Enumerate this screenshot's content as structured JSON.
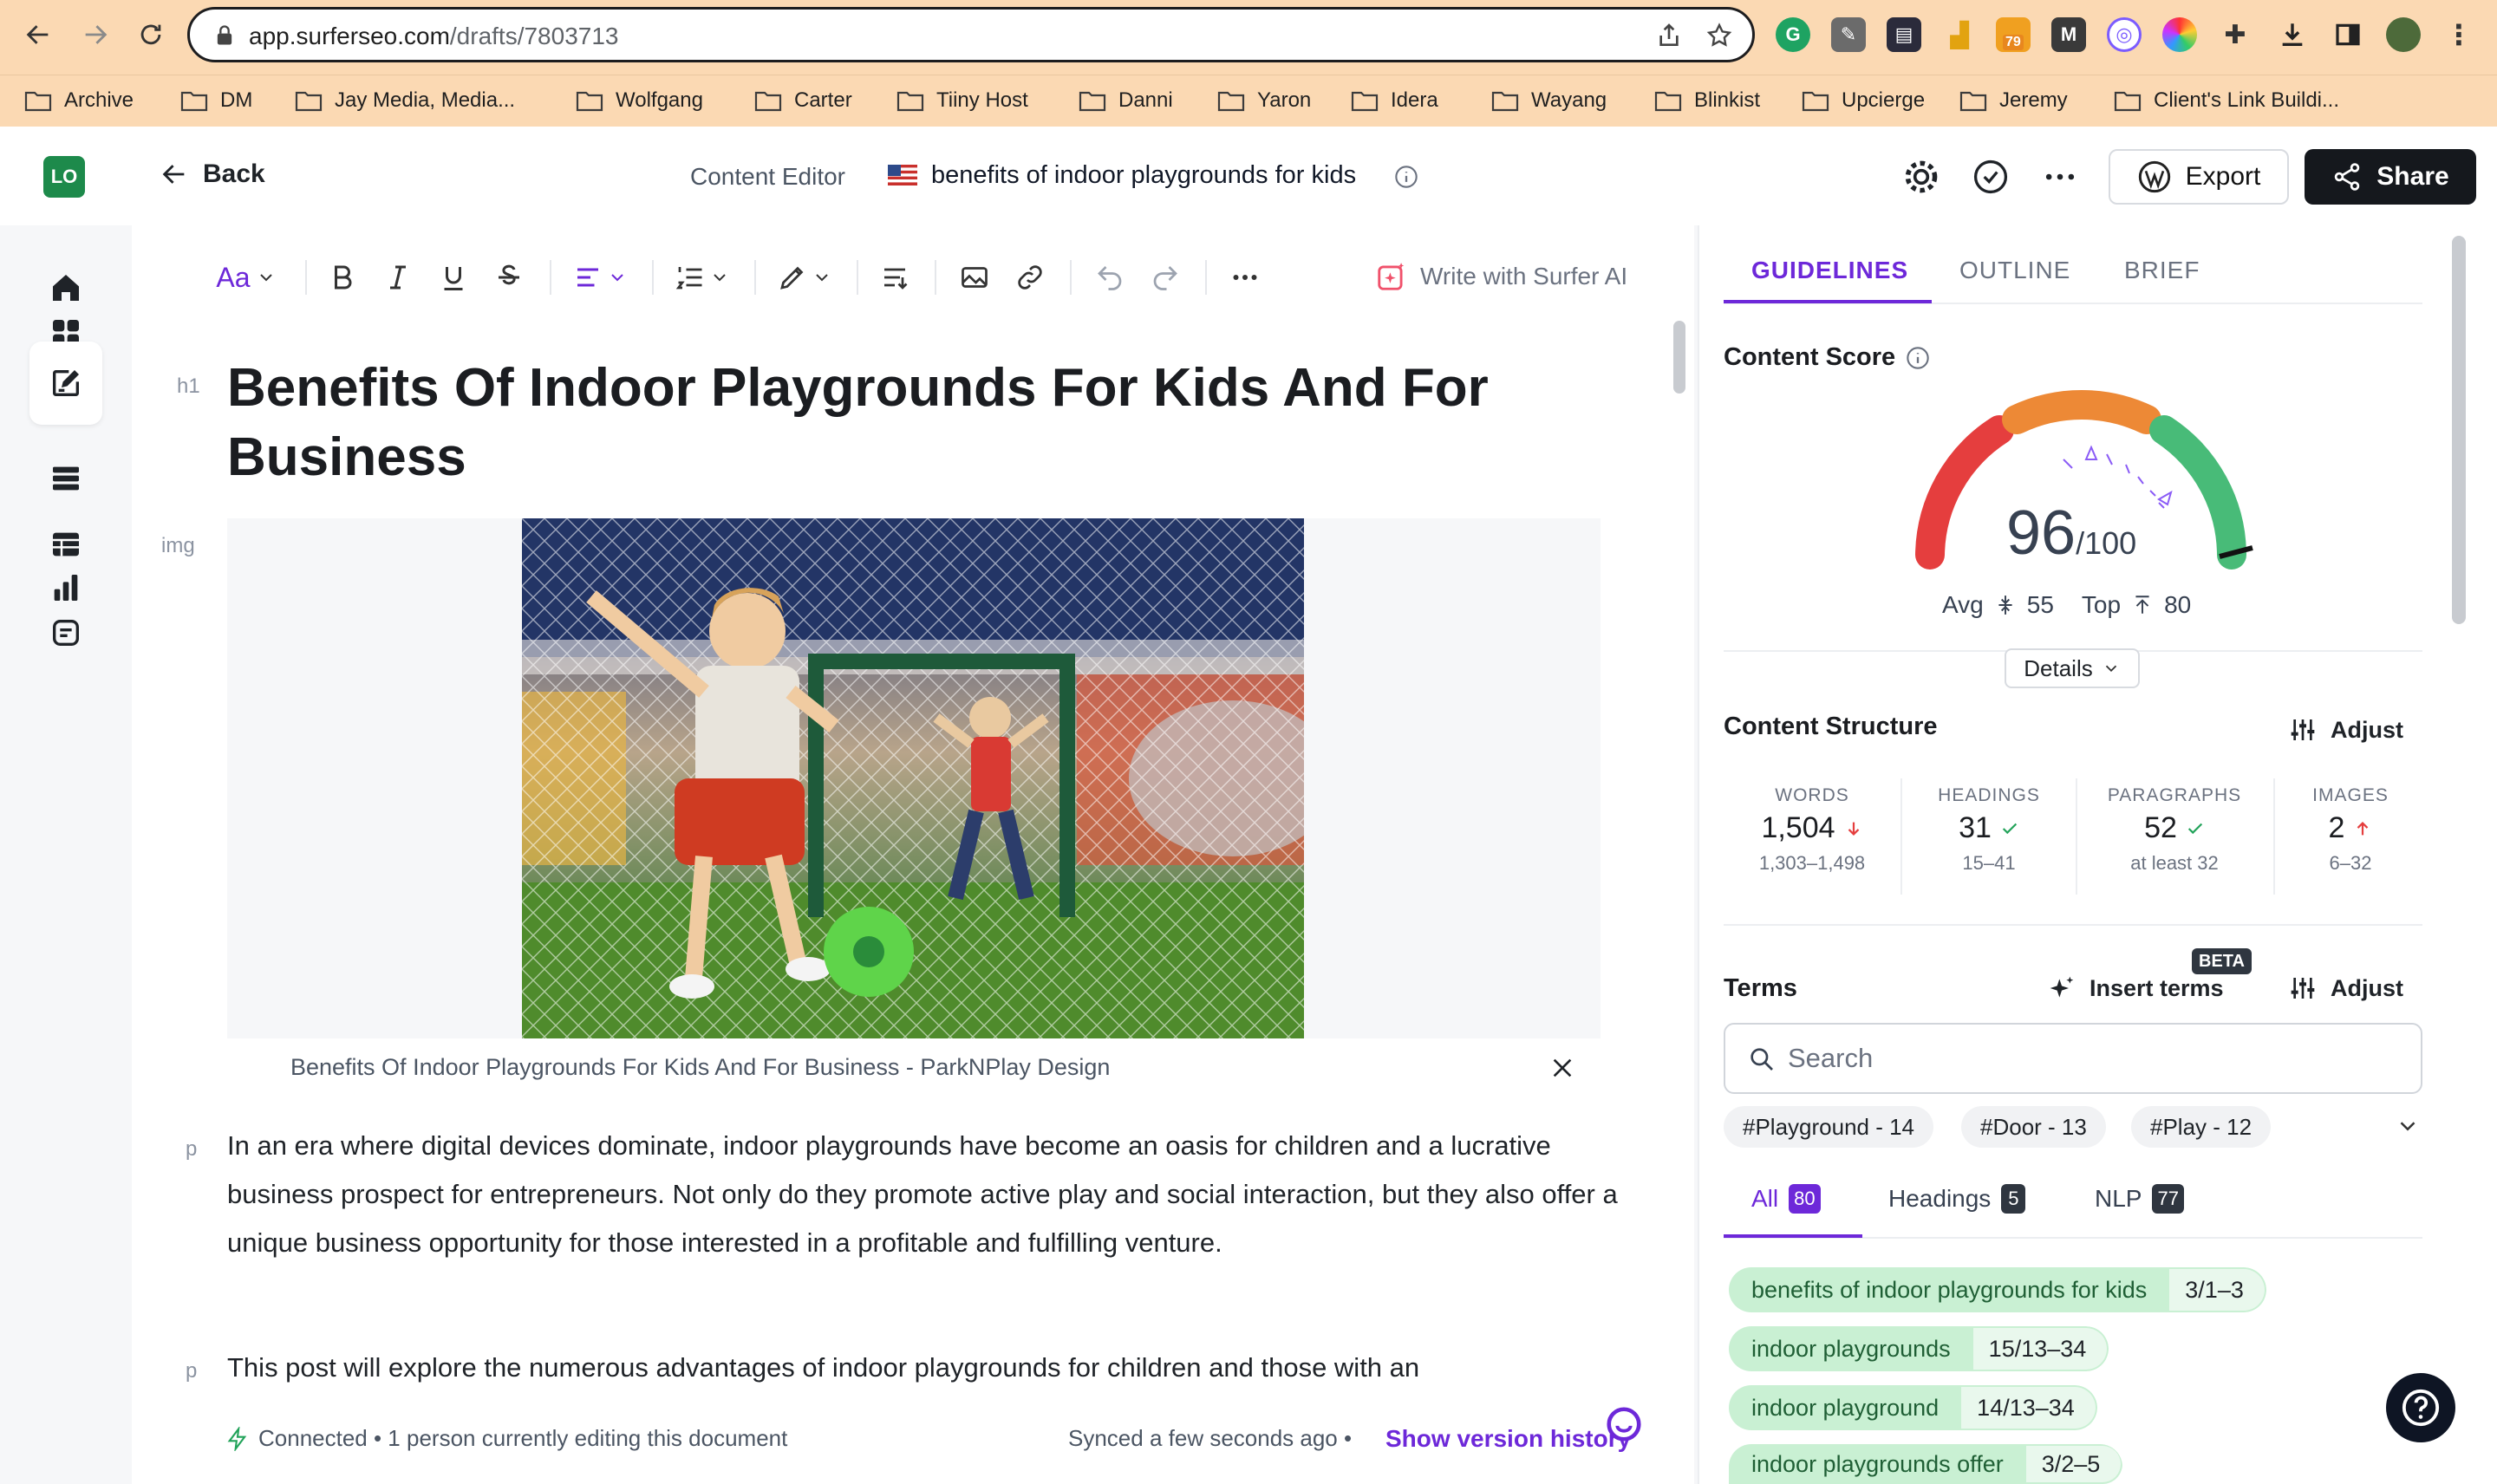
{
  "browser": {
    "url_host": "app.surferseo.com",
    "url_path": "/drafts/7803713",
    "extension_badge": "79",
    "bookmarks": [
      "Archive",
      "DM",
      "Jay Media, Media...",
      "Wolfgang",
      "Carter",
      "Tiiny Host",
      "Danni",
      "Yaron",
      "Idera",
      "Wayang",
      "Blinkist",
      "Upcierge",
      "Jeremy",
      "Client's Link Buildi..."
    ]
  },
  "header": {
    "logo": "LO",
    "back_label": "Back",
    "editor_label": "Content Editor",
    "doc_title": "benefits of indoor playgrounds for kids",
    "export_label": "Export",
    "share_label": "Share"
  },
  "toolbar": {
    "text_style": "Aa",
    "surfer_ai_label": "Write with Surfer AI"
  },
  "document": {
    "h1_tag": "h1",
    "img_tag": "img",
    "p_tag": "p",
    "h1": "Benefits Of Indoor Playgrounds For Kids And For Business",
    "caption": "Benefits Of Indoor Playgrounds For Kids And For Business - ParkNPlay Design",
    "paragraph1": "In an era where digital devices dominate, indoor playgrounds have become an oasis for children and a lucrative business prospect for entrepreneurs. Not only do they promote active play and social interaction, but they also offer a unique business opportunity for those interested in a profitable and fulfilling venture.",
    "paragraph2": "This post will explore the numerous advantages of indoor playgrounds for children and those with an"
  },
  "status": {
    "connected": "Connected • 1 person currently editing this document",
    "synced": "Synced a few seconds ago •",
    "version_history": "Show version history"
  },
  "panel": {
    "tabs": [
      "GUIDELINES",
      "OUTLINE",
      "BRIEF"
    ],
    "content_score_title": "Content Score",
    "score": "96",
    "score_max": "/100",
    "score_value": 96,
    "avg_label": "Avg",
    "avg_value": "55",
    "top_label": "Top",
    "top_value": "80",
    "details_label": "Details",
    "structure_title": "Content Structure",
    "adjust_label": "Adjust",
    "stats": [
      {
        "label": "WORDS",
        "value": "1,504",
        "range": "1,303–1,498",
        "status": "down"
      },
      {
        "label": "HEADINGS",
        "value": "31",
        "range": "15–41",
        "status": "ok"
      },
      {
        "label": "PARAGRAPHS",
        "value": "52",
        "range": "at least 32",
        "status": "ok"
      },
      {
        "label": "IMAGES",
        "value": "2",
        "range": "6–32",
        "status": "up"
      }
    ],
    "terms_title": "Terms",
    "insert_terms_label": "Insert terms",
    "beta_label": "BETA",
    "search_placeholder": "Search",
    "chips": [
      "#Playground - 14",
      "#Door - 13",
      "#Play - 12"
    ],
    "filter_tabs": [
      {
        "label": "All",
        "count": "80"
      },
      {
        "label": "Headings",
        "count": "5"
      },
      {
        "label": "NLP",
        "count": "77"
      }
    ],
    "terms": [
      {
        "term": "benefits of indoor playgrounds for kids",
        "count": "3/1–3"
      },
      {
        "term": "indoor playgrounds",
        "count": "15/13–34"
      },
      {
        "term": "indoor playground",
        "count": "14/13–34"
      },
      {
        "term": "indoor playgrounds offer",
        "count": "3/2–5"
      }
    ]
  },
  "colors": {
    "accent": "#6d28d9",
    "gauge_red": "#e53e3e",
    "gauge_orange": "#ed8936",
    "gauge_green": "#48bb78",
    "chrome_bg": "#fbd9b3"
  }
}
